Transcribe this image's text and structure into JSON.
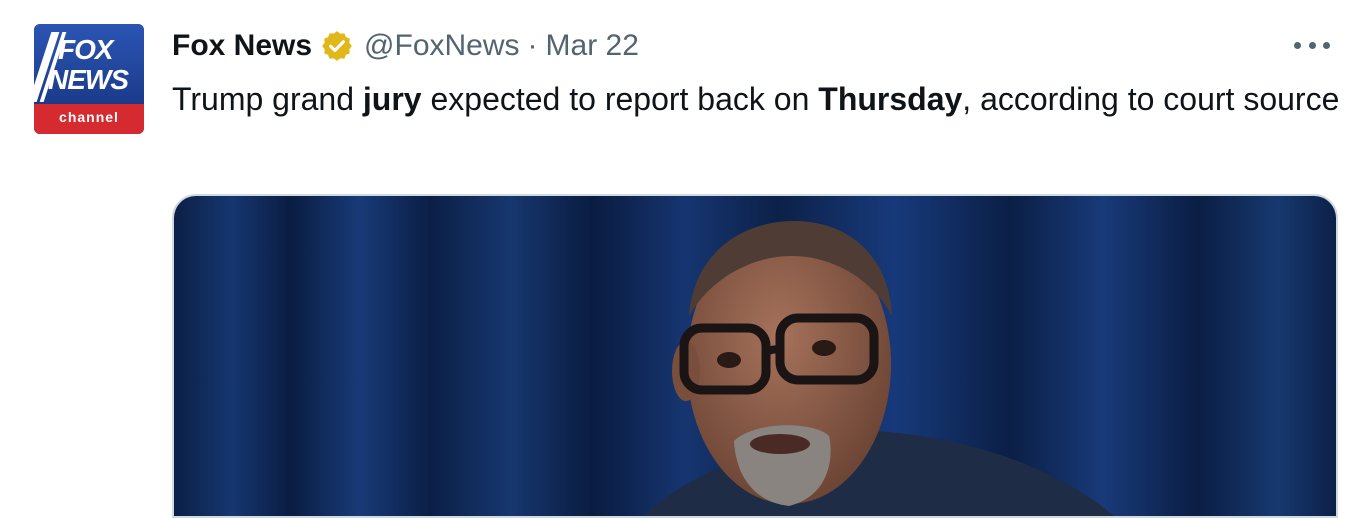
{
  "account": {
    "avatar_lines": [
      "FOX",
      "NEWS",
      "channel"
    ],
    "name": "Fox News",
    "handle": "@FoxNews",
    "separator": "·",
    "date": "Mar 22"
  },
  "tweet": {
    "text_parts": [
      "Trump grand ",
      "jury",
      " expected to report back on ",
      "Thursday",
      ", according to court source"
    ]
  },
  "colors": {
    "verified_badge": "#e2b719",
    "secondary_text": "#536471",
    "curtain": "#0d2550"
  },
  "icons": [
    "verified-badge-icon",
    "more-options-icon"
  ]
}
